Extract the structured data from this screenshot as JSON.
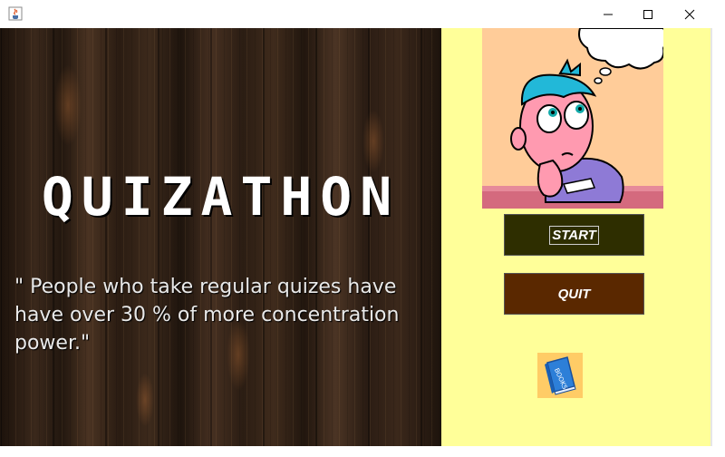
{
  "window": {
    "app_icon": "java-cup-icon",
    "controls": [
      "minimize-icon",
      "maximize-icon",
      "close-icon"
    ]
  },
  "main": {
    "title": "QUIZATHON",
    "quote": "\" People who take regular quizes have have over 30 % of more concentration power.\""
  },
  "sidebar": {
    "start_label": "START",
    "quit_label": "QUIT",
    "books_label": "BOOKS"
  },
  "colors": {
    "panel": "#ffff99",
    "start_button": "#2e2e00",
    "quit_button": "#5a2800",
    "text": "#ffffff"
  }
}
